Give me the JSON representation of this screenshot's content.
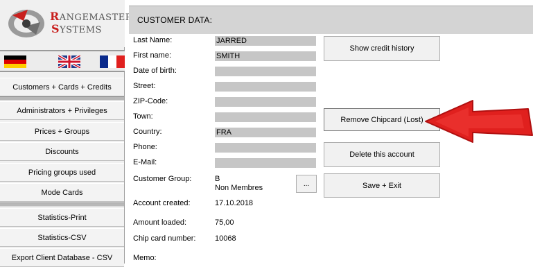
{
  "logo": {
    "line1_cap": "R",
    "line1_rest": "ANGEMASTER",
    "line2_cap": "S",
    "line2_rest": "YSTEMS"
  },
  "flags": [
    "german-flag",
    "uk-flag",
    "french-flag"
  ],
  "sidebar": {
    "items": [
      "Customers + Cards + Credits",
      "Administrators + Privileges",
      "Prices + Groups",
      "Discounts",
      "Pricing groups used",
      "Mode Cards",
      "Statistics-Print",
      "Statistics-CSV",
      "Export Client Database - CSV"
    ]
  },
  "header": {
    "title": "CUSTOMER DATA:"
  },
  "form": {
    "last_name_label": "Last Name:",
    "last_name": "JARRED",
    "first_name_label": "First name:",
    "first_name": "SMITH",
    "dob_label": "Date of birth:",
    "dob": "",
    "street_label": "Street:",
    "street": "",
    "zip_label": "ZIP-Code:",
    "zip": "",
    "town_label": "Town:",
    "town": "",
    "country_label": "Country:",
    "country": "FRA",
    "phone_label": "Phone:",
    "phone": "",
    "email_label": "E-Mail:",
    "email": "",
    "group_label": "Customer Group:",
    "group_code": "B",
    "group_name": "Non Membres",
    "group_button": "...",
    "created_label": "Account created:",
    "created": "17.10.2018",
    "amount_label": "Amount loaded:",
    "amount": "75,00",
    "chip_label": "Chip card number:",
    "chip": "10068",
    "memo_label": "Memo:"
  },
  "buttons": {
    "credit_history": "Show credit history",
    "remove_chipcard": "Remove Chipcard  (Lost)",
    "delete_account": "Delete this account",
    "save_exit": "Save + Exit"
  },
  "colors": {
    "accent_red": "#e0201e",
    "field_gray": "#c6c6c6",
    "header_gray": "#d4d4d4"
  }
}
